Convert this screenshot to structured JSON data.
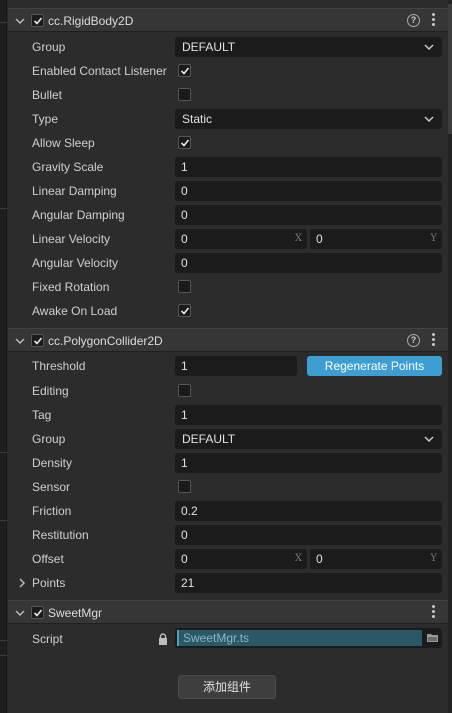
{
  "rigidbody": {
    "title": "cc.RigidBody2D",
    "group_label": "Group",
    "group_value": "DEFAULT",
    "contact_label": "Enabled Contact Listener",
    "bullet_label": "Bullet",
    "type_label": "Type",
    "type_value": "Static",
    "allow_sleep_label": "Allow Sleep",
    "gravity_label": "Gravity Scale",
    "gravity_value": "1",
    "lin_damp_label": "Linear Damping",
    "lin_damp_value": "0",
    "ang_damp_label": "Angular Damping",
    "ang_damp_value": "0",
    "lin_vel_label": "Linear Velocity",
    "lin_vel_x": "0",
    "lin_vel_y": "0",
    "ang_vel_label": "Angular Velocity",
    "ang_vel_value": "0",
    "fixed_rot_label": "Fixed Rotation",
    "awake_label": "Awake On Load",
    "checks": {
      "enabled": true,
      "contact": true,
      "bullet": false,
      "allow_sleep": true,
      "fixed_rotation": false,
      "awake": true
    }
  },
  "polygon": {
    "title": "cc.PolygonCollider2D",
    "threshold_label": "Threshold",
    "threshold_value": "1",
    "regenerate_label": "Regenerate Points",
    "editing_label": "Editing",
    "tag_label": "Tag",
    "tag_value": "1",
    "group_label": "Group",
    "group_value": "DEFAULT",
    "density_label": "Density",
    "density_value": "1",
    "sensor_label": "Sensor",
    "friction_label": "Friction",
    "friction_value": "0.2",
    "restitution_label": "Restitution",
    "restitution_value": "0",
    "offset_label": "Offset",
    "offset_x": "0",
    "offset_y": "0",
    "points_label": "Points",
    "points_value": "21",
    "checks": {
      "enabled": true,
      "editing": false,
      "sensor": false
    }
  },
  "sweet": {
    "title": "SweetMgr",
    "script_label": "Script",
    "script_value": "SweetMgr.ts",
    "checks": {
      "enabled": true
    }
  },
  "axis": {
    "x": "X",
    "y": "Y"
  },
  "help_glyph": "?",
  "add_component_label": "添加组件",
  "colors": {
    "accent": "#3d9fd1",
    "background": "#2c2c2c",
    "field": "#1b1b1b"
  },
  "icons": [
    "chevron-down-icon",
    "chevron-right-icon",
    "check-icon",
    "help-icon",
    "more-icon",
    "lock-icon",
    "folder-icon"
  ]
}
